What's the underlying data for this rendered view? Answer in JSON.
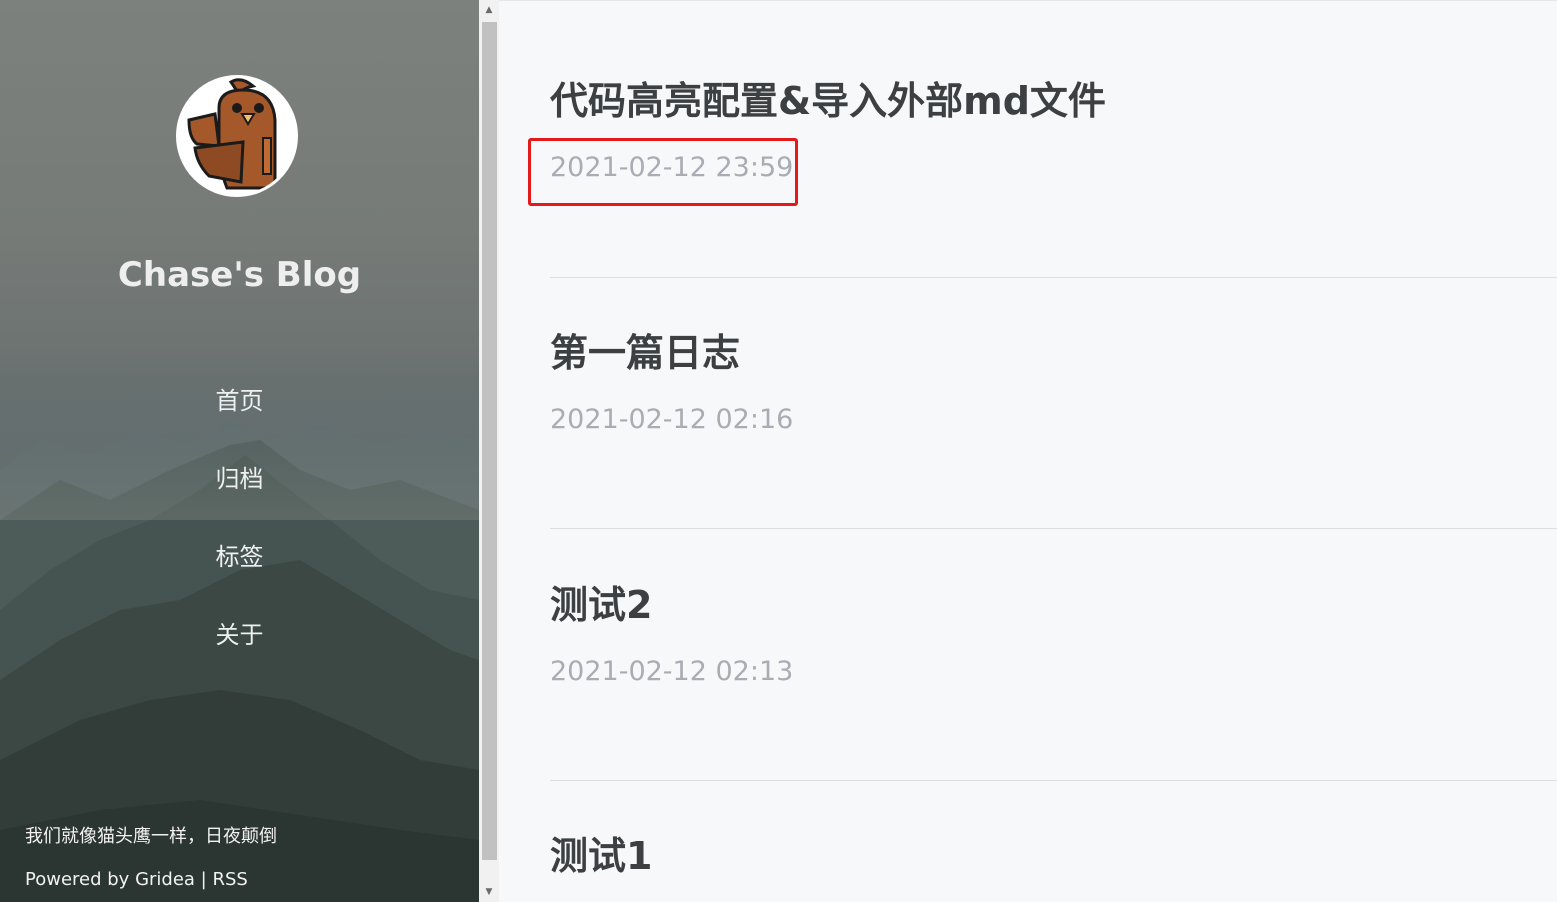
{
  "sidebar": {
    "blog_title": "Chase's Blog",
    "nav": [
      {
        "label": "首页"
      },
      {
        "label": "归档"
      },
      {
        "label": "标签"
      },
      {
        "label": "关于"
      }
    ],
    "motto": "我们就像猫头鹰一样，日夜颠倒",
    "powered_prefix": "Powered by ",
    "powered_link": "Gridea",
    "powered_sep": " | ",
    "rss_link": "RSS",
    "avatar_icon": "owl-avatar-icon"
  },
  "posts": [
    {
      "title": "代码高亮配置&导入外部md文件",
      "date": "2021-02-12 23:59"
    },
    {
      "title": "第一篇日志",
      "date": "2021-02-12 02:16"
    },
    {
      "title": "测试2",
      "date": "2021-02-12 02:13"
    },
    {
      "title": "测试1",
      "date": ""
    }
  ],
  "colors": {
    "title_text": "#3c4043",
    "date_text": "#a9adb3",
    "highlight": "#e21a1a",
    "background": "#f7f8fa"
  }
}
